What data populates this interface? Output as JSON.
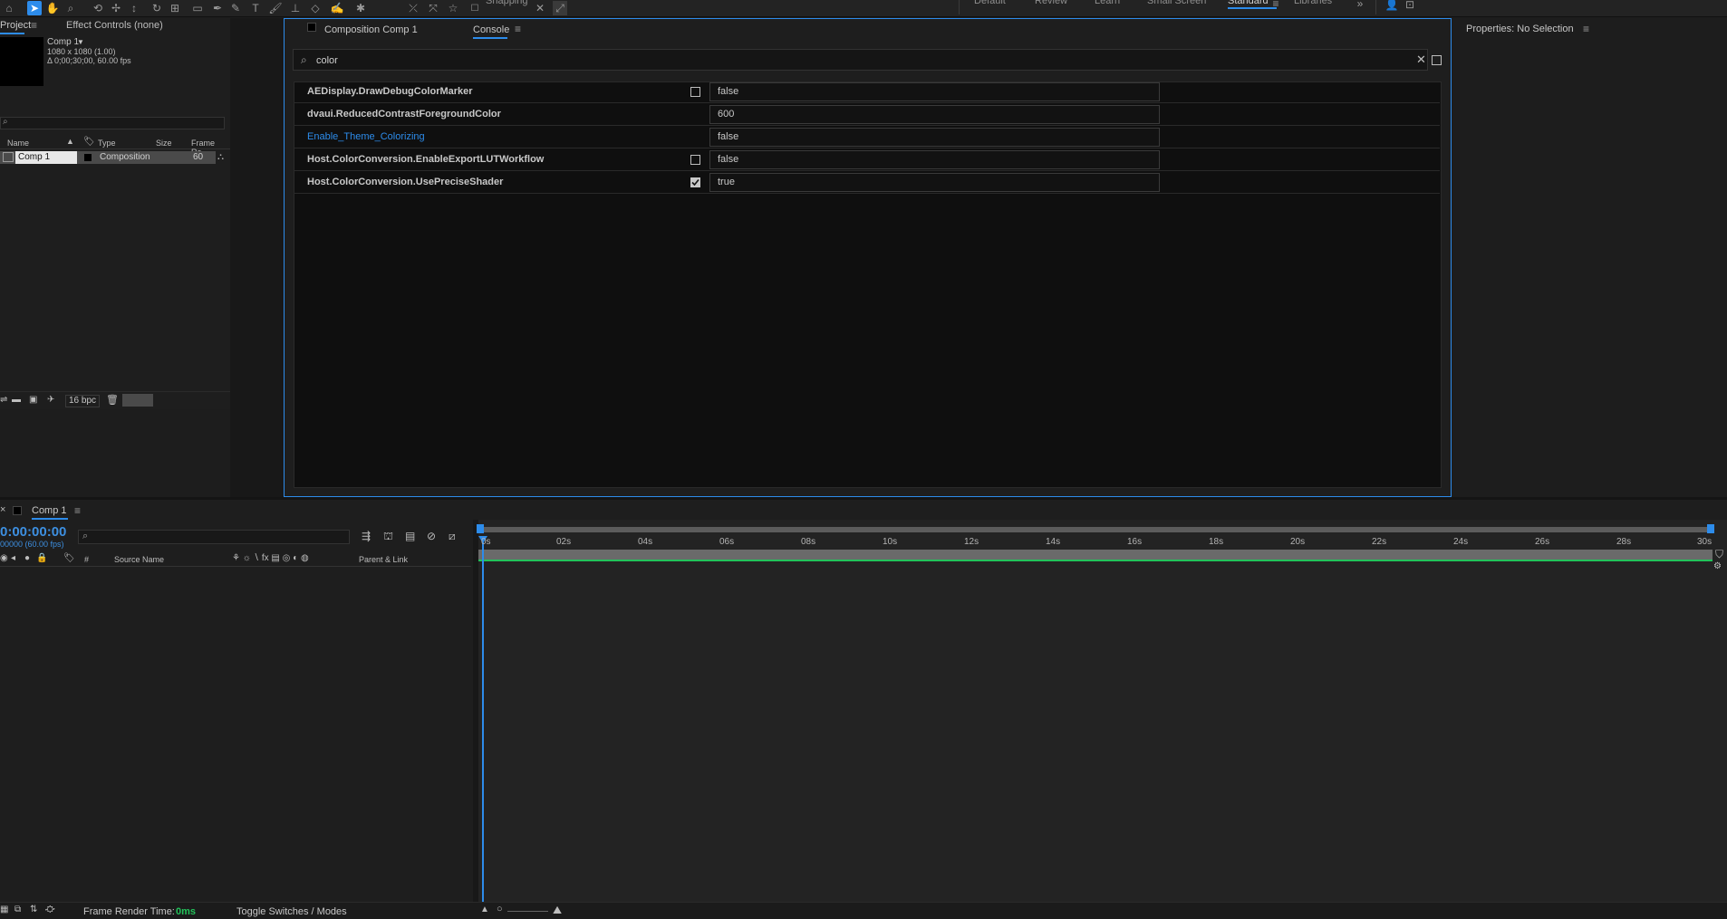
{
  "toolbar": {
    "snapping_label": "Snapping",
    "workspaces": [
      "Default",
      "Review",
      "Learn",
      "Small Screen",
      "Standard",
      "Libraries"
    ]
  },
  "project": {
    "tab_label": "Project",
    "effect_controls_label": "Effect Controls (none)",
    "comp_name": "Comp 1",
    "comp_size": "1080 x 1080 (1.00)",
    "comp_duration": "Δ 0;00;30;00, 60.00 fps",
    "columns": {
      "name": "Name",
      "type": "Type",
      "size": "Size",
      "frame_rate": "Frame Ra..."
    },
    "items": [
      {
        "name": "Comp 1",
        "type": "Composition",
        "frame_rate": "60"
      }
    ],
    "bpc": "16 bpc"
  },
  "center": {
    "composition_tab": "Composition Comp 1",
    "console_tab": "Console",
    "search_value": "color",
    "rows": [
      {
        "label": "AEDisplay.DrawDebugColorMarker",
        "value": "false",
        "checkbox": "unchecked"
      },
      {
        "label": "dvaui.ReducedContrastForegroundColor",
        "value": "600",
        "checkbox": "none"
      },
      {
        "label": "Enable_Theme_Colorizing",
        "value": "false",
        "checkbox": "none",
        "highlight_color": "#2d8ceb"
      },
      {
        "label": "Host.ColorConversion.EnableExportLUTWorkflow",
        "value": "false",
        "checkbox": "unchecked"
      },
      {
        "label": "Host.ColorConversion.UsePreciseShader",
        "value": "true",
        "checkbox": "checked"
      }
    ]
  },
  "properties": {
    "title": "Properties: No Selection"
  },
  "timeline": {
    "tab_label": "Comp 1",
    "timecode": "0:00:00:00",
    "fps_label": "00000 (60.00 fps)",
    "source_name_header": "Source Name",
    "parent_link_header": "Parent & Link",
    "hash_header": "#",
    "ruler_ticks": [
      "0s",
      "02s",
      "04s",
      "06s",
      "08s",
      "10s",
      "12s",
      "14s",
      "16s",
      "18s",
      "20s",
      "22s",
      "24s",
      "26s",
      "28s",
      "30s"
    ]
  },
  "status": {
    "render_time_label": "Frame Render Time:",
    "render_time_value": "0ms",
    "toggle_label": "Toggle Switches / Modes"
  },
  "colors": {
    "accent": "#2d8ceb",
    "timecode": "#3d8fe0",
    "work_area_line": "#22c35a"
  }
}
